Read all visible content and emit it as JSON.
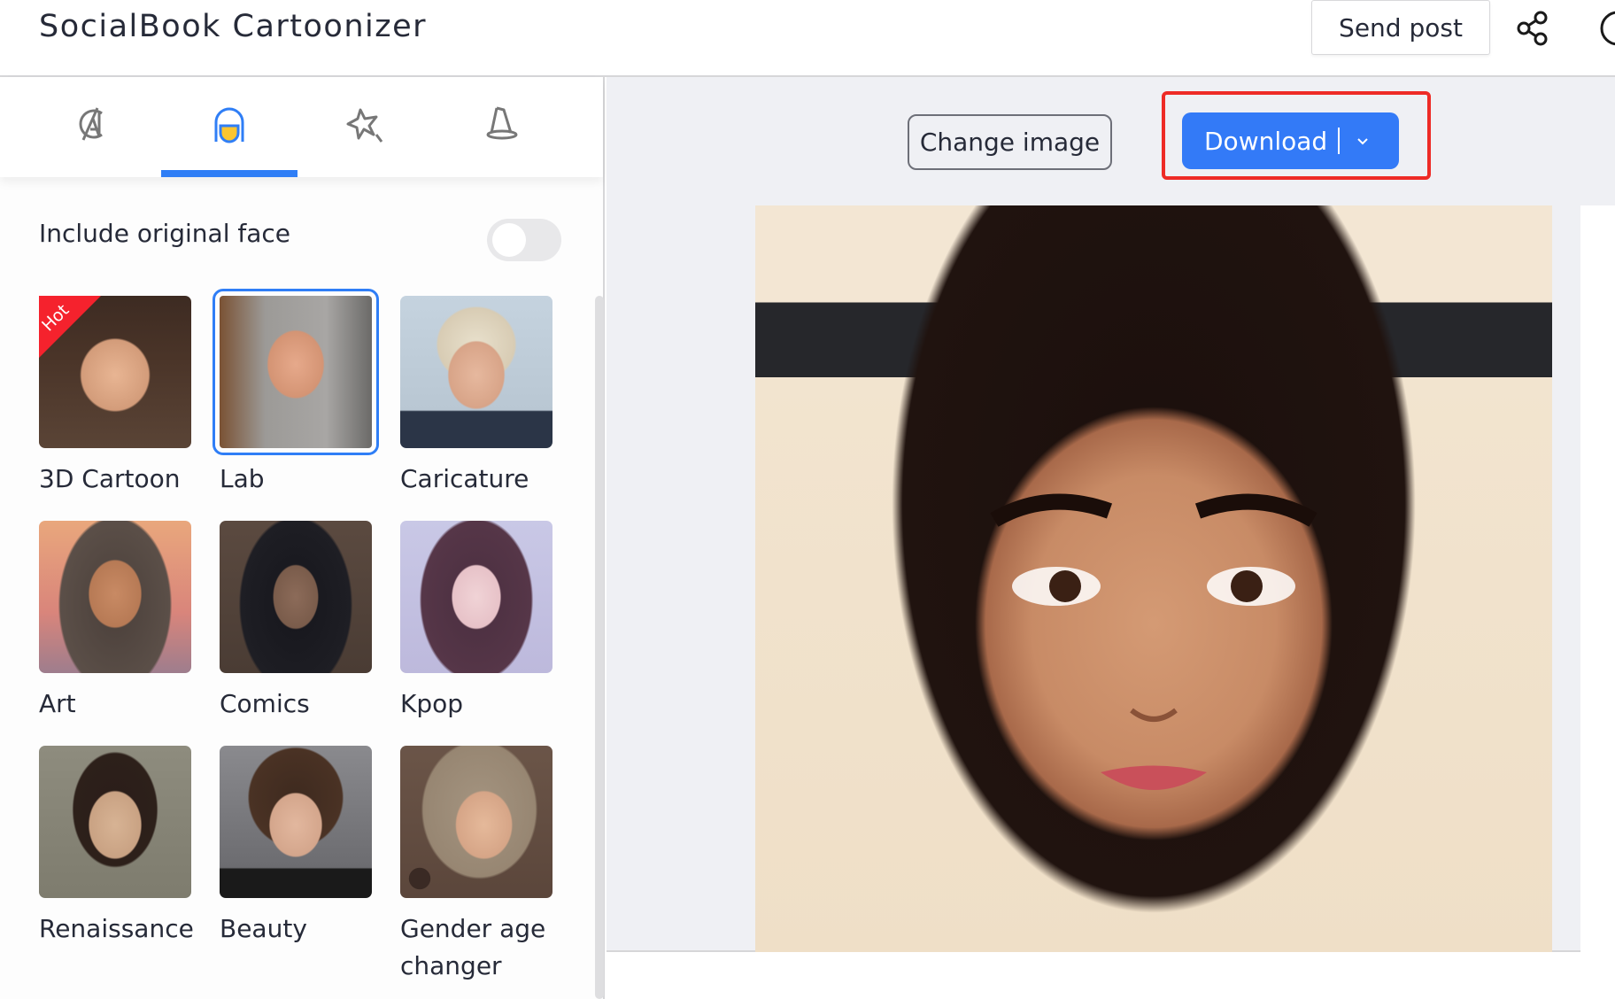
{
  "header": {
    "title": "SocialBook Cartoonizer",
    "send_post_label": "Send post",
    "share_icon": "share-icon",
    "account_icon": "account-icon"
  },
  "sidebar": {
    "tabs": [
      {
        "icon": "avengers-icon",
        "active": false
      },
      {
        "icon": "character-icon",
        "active": true
      },
      {
        "icon": "magic-wand-star-icon",
        "active": false
      },
      {
        "icon": "witch-hat-icon",
        "active": false
      }
    ],
    "include_original_face": {
      "label": "Include original face",
      "enabled": false
    },
    "styles": [
      {
        "label": "3D Cartoon",
        "badge": "Hot",
        "selected": false
      },
      {
        "label": "Lab",
        "selected": true
      },
      {
        "label": "Caricature",
        "selected": false
      },
      {
        "label": "Art",
        "selected": false
      },
      {
        "label": "Comics",
        "selected": false
      },
      {
        "label": "Kpop",
        "selected": false
      },
      {
        "label": "Renaissance",
        "selected": false
      },
      {
        "label": "Beauty",
        "selected": false
      },
      {
        "label": "Gender age changer",
        "selected": false
      }
    ]
  },
  "main": {
    "change_image_label": "Change image",
    "download_label": "Download",
    "colors": {
      "accent": "#337af7",
      "highlight": "#ee2b26",
      "hot_badge": "#f5222d"
    }
  }
}
